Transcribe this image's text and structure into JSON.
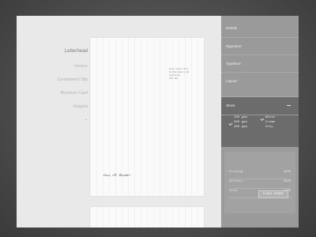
{
  "nav": {
    "items": [
      "Letterhead",
      "Invoice",
      "Compliment Slip",
      "Business Card",
      "Insignia"
    ],
    "active_index": 0
  },
  "preview": {
    "address_lines": [
      "Bruce House Hall",
      "10 Noblesbury Rd",
      "Townfield",
      "TW4 3LN"
    ]
  },
  "panel": {
    "sections": [
      "Details",
      "Signature",
      "Typeface",
      "Layout",
      "Stock"
    ],
    "stock": {
      "weights": [
        "100 gsm",
        "200 gsm",
        "300 gsm"
      ],
      "selected_weight": "200 gsm",
      "finishes": [
        "White",
        "Cream",
        "Grey"
      ],
      "selected_finish": "White"
    },
    "summary": [
      {
        "label": "Printing",
        "value": "$100"
      },
      {
        "label": "Delivery",
        "value": "$100"
      },
      {
        "label": "Total",
        "value": "$200"
      }
    ],
    "order_button": "PLACE ORDER"
  },
  "colors": {
    "panel": "#9a9a9a",
    "panel_active": "#6c6c6c",
    "screen_bg": "#e9e9e9"
  }
}
